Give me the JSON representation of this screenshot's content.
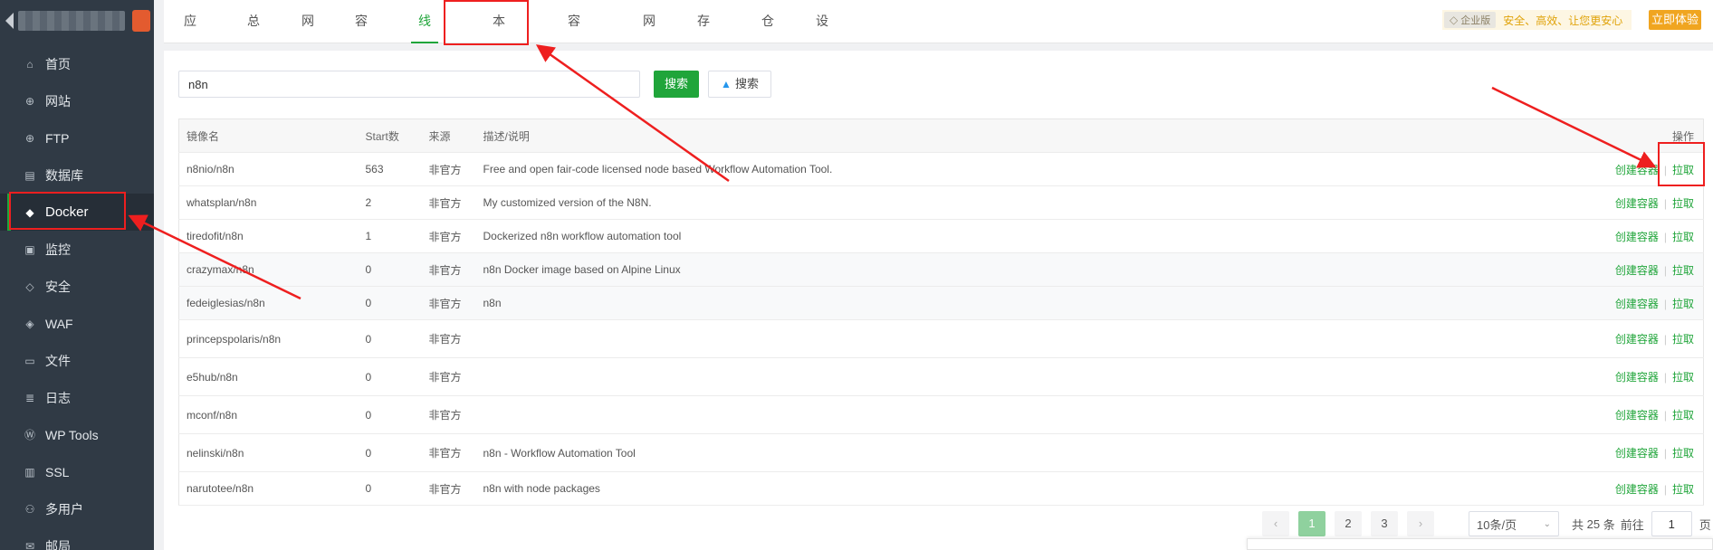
{
  "sidebar": {
    "items": [
      {
        "icon": "home-icon",
        "glyph": "⌂",
        "label": "首页"
      },
      {
        "icon": "globe-icon",
        "glyph": "⊕",
        "label": "网站"
      },
      {
        "icon": "ftp-icon",
        "glyph": "⊕",
        "label": "FTP"
      },
      {
        "icon": "database-icon",
        "glyph": "▤",
        "label": "数据库"
      },
      {
        "icon": "docker-icon",
        "glyph": "◆",
        "label": "Docker"
      },
      {
        "icon": "monitor-icon",
        "glyph": "▣",
        "label": "监控"
      },
      {
        "icon": "shield-icon",
        "glyph": "◇",
        "label": "安全"
      },
      {
        "icon": "waf-icon",
        "glyph": "◈",
        "label": "WAF"
      },
      {
        "icon": "folder-icon",
        "glyph": "▭",
        "label": "文件"
      },
      {
        "icon": "log-icon",
        "glyph": "≣",
        "label": "日志"
      },
      {
        "icon": "wordpress-icon",
        "glyph": "Ⓦ",
        "label": "WP Tools"
      },
      {
        "icon": "ssl-icon",
        "glyph": "▥",
        "label": "SSL"
      },
      {
        "icon": "users-icon",
        "glyph": "⚇",
        "label": "多用户"
      },
      {
        "icon": "mail-icon",
        "glyph": "✉",
        "label": "邮局"
      }
    ]
  },
  "tabs": [
    "应用商店",
    "总览",
    "网站",
    "容器",
    "线上镜像",
    "本地镜像",
    "容器编排",
    "网络",
    "存储卷",
    "仓库",
    "设置"
  ],
  "enterprise": {
    "badge": "企业版",
    "slogan": "安全、高效、让您更安心",
    "try_label": "立即体验"
  },
  "search": {
    "value": "n8n",
    "search_label": "搜索",
    "docker_search_label": "搜索"
  },
  "table": {
    "headers": {
      "name": "镜像名",
      "stars": "Start数",
      "source": "来源",
      "desc": "描述/说明",
      "op": "操作"
    },
    "create_label": "创建容器",
    "pull_label": "拉取",
    "rows": [
      {
        "name": "n8nio/n8n",
        "stars": "563",
        "source": "非官方",
        "desc": "Free and open fair-code licensed node based Workflow Automation Tool."
      },
      {
        "name": "whatsplan/n8n",
        "stars": "2",
        "source": "非官方",
        "desc": "My customized version of the N8N."
      },
      {
        "name": "tiredofit/n8n",
        "stars": "1",
        "source": "非官方",
        "desc": "Dockerized n8n workflow automation tool"
      },
      {
        "name": "crazymax/n8n",
        "stars": "0",
        "source": "非官方",
        "desc": "n8n Docker image based on Alpine Linux"
      },
      {
        "name": "fedeiglesias/n8n",
        "stars": "0",
        "source": "非官方",
        "desc": "n8n"
      },
      {
        "name": "princepspolaris/n8n",
        "stars": "0",
        "source": "非官方",
        "desc": ""
      },
      {
        "name": "e5hub/n8n",
        "stars": "0",
        "source": "非官方",
        "desc": ""
      },
      {
        "name": "mconf/n8n",
        "stars": "0",
        "source": "非官方",
        "desc": ""
      },
      {
        "name": "nelinski/n8n",
        "stars": "0",
        "source": "非官方",
        "desc": "n8n - Workflow Automation Tool"
      },
      {
        "name": "narutotee/n8n",
        "stars": "0",
        "source": "非官方",
        "desc": "n8n with node packages"
      }
    ]
  },
  "pagination": {
    "prev": "‹",
    "next": "›",
    "pages": [
      "1",
      "2",
      "3"
    ],
    "page_size": "10条/页",
    "total_prefix": "共",
    "total": "25",
    "total_suffix": "条",
    "goto_prefix": "前往",
    "goto_value": "1",
    "goto_suffix": "页"
  },
  "colors": {
    "accent": "#20a53a",
    "sidebar_bg": "#303a45",
    "annotation": "#ee1f1f",
    "try_button": "#f0a520"
  }
}
